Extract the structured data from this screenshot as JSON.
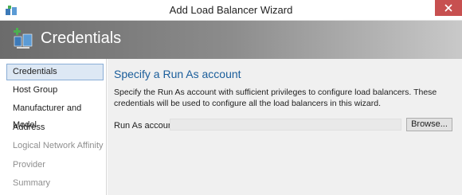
{
  "window": {
    "title": "Add Load Balancer Wizard"
  },
  "banner": {
    "title": "Credentials"
  },
  "sidebar": {
    "items": [
      {
        "label": "Credentials",
        "state": "selected"
      },
      {
        "label": "Host Group",
        "state": "enabled"
      },
      {
        "label": "Manufacturer and Model",
        "state": "enabled"
      },
      {
        "label": "Address",
        "state": "enabled"
      },
      {
        "label": "Logical Network Affinity",
        "state": "disabled"
      },
      {
        "label": "Provider",
        "state": "disabled"
      },
      {
        "label": "Summary",
        "state": "disabled"
      }
    ]
  },
  "main": {
    "heading": "Specify a Run As account",
    "description": "Specify the Run As account with sufficient privileges to configure load balancers. These credentials will be used to configure all the load balancers in this wizard.",
    "run_as": {
      "label": "Run As account:",
      "value": "",
      "browse_label": "Browse..."
    }
  },
  "colors": {
    "heading": "#1a5d9a",
    "selected_bg": "#dde8f4",
    "close_button": "#c75050",
    "disabled_text": "#8f8f8f"
  }
}
